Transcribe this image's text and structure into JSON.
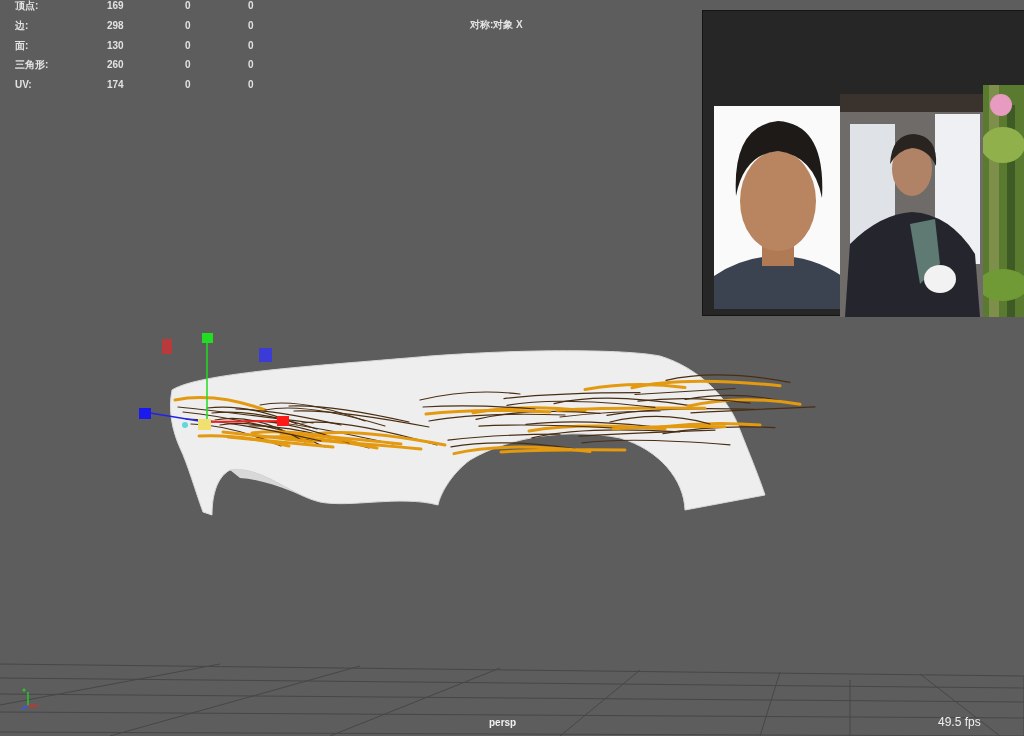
{
  "hud": {
    "rows": [
      {
        "label": "顶点:",
        "values": [
          "169",
          "0",
          "0"
        ]
      },
      {
        "label": "边:",
        "values": [
          "298",
          "0",
          "0"
        ]
      },
      {
        "label": "面:",
        "values": [
          "130",
          "0",
          "0"
        ]
      },
      {
        "label": "三角形:",
        "values": [
          "260",
          "0",
          "0"
        ]
      },
      {
        "label": "UV:",
        "values": [
          "174",
          "0",
          "0"
        ]
      }
    ]
  },
  "symmetry": "对称:对象 X",
  "camera": "persp",
  "fps": "49.5 fps"
}
